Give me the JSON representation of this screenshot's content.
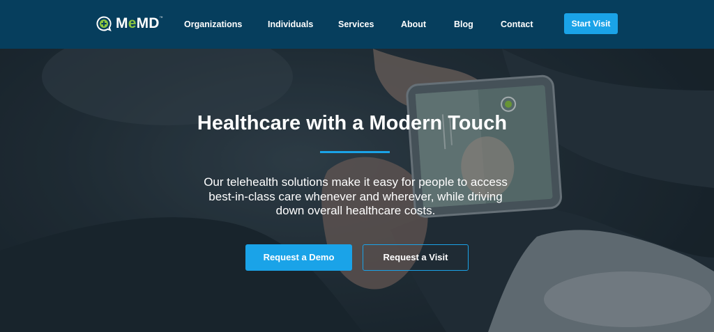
{
  "brand": {
    "name_prefix": "M",
    "name_accent": "e",
    "name_suffix": "MD",
    "trademark": "™",
    "accent_color": "#8dc63f",
    "icon": "plus-chat-bubble-icon"
  },
  "nav": {
    "items": [
      "Organizations",
      "Individuals",
      "Services",
      "About",
      "Blog",
      "Contact"
    ],
    "cta_label": "Start Visit"
  },
  "hero": {
    "title": "Healthcare with a Modern Touch",
    "body": "Our telehealth solutions make it easy for people to access best-in-class care whenever and wherever, while driving down overall healthcare costs.",
    "primary_button": "Request a Demo",
    "secondary_button": "Request a Visit"
  },
  "colors": {
    "header_bg": "#063e5d",
    "accent_blue": "#1aa3e8",
    "text": "#ffffff"
  }
}
